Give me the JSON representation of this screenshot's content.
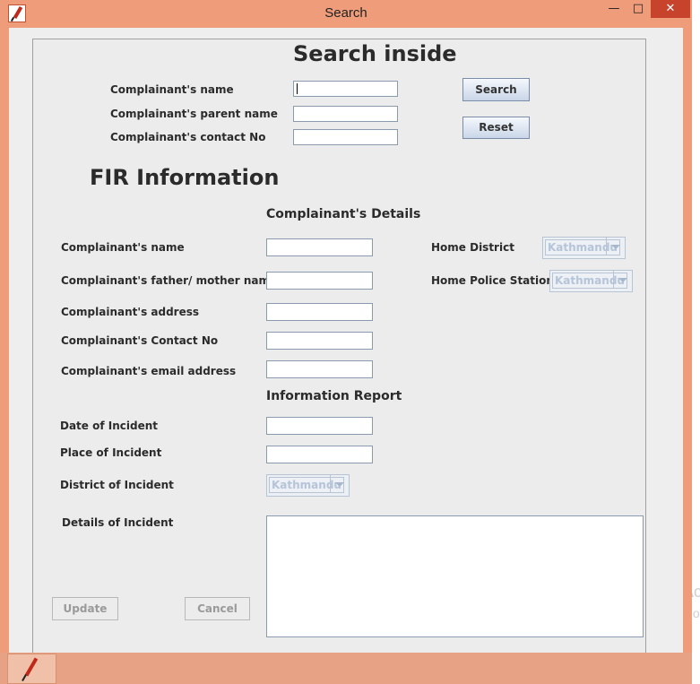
{
  "window": {
    "title": "Search",
    "minimize_glyph": "—",
    "maximize_glyph": "□",
    "close_glyph": "✕"
  },
  "search": {
    "heading": "Search inside",
    "name_label": "Complainant's name",
    "parent_label": "Complainant's parent name",
    "contact_label": "Complainant's contact No",
    "search_button": "Search",
    "reset_button": "Reset"
  },
  "fir": {
    "heading": "FIR Information",
    "details_heading": "Complainant's Details",
    "name_label": "Complainant's name",
    "parent_label": "Complainant's father/ mother name",
    "address_label": "Complainant's address",
    "contact_label": "Complainant's Contact No",
    "email_label": "Complainant's email address",
    "home_district_label": "Home District",
    "home_district_value": "Kathmandu",
    "home_station_label": "Home Police Station",
    "home_station_value": "Kathmandu"
  },
  "report": {
    "heading": "Information Report",
    "date_label": "Date of Incident",
    "place_label": "Place of Incident",
    "district_label": "District of Incident",
    "district_value": "Kathmandu",
    "details_label": "Details of Incident"
  },
  "actions": {
    "update_button": "Update",
    "cancel_button": "Cancel"
  },
  "background": {
    "ghost_text_1": "Ac",
    "ghost_text_2": "Go"
  },
  "colors": {
    "frame": "#ef9c7b",
    "close_button": "#c7432c",
    "panel": "#ececec"
  }
}
